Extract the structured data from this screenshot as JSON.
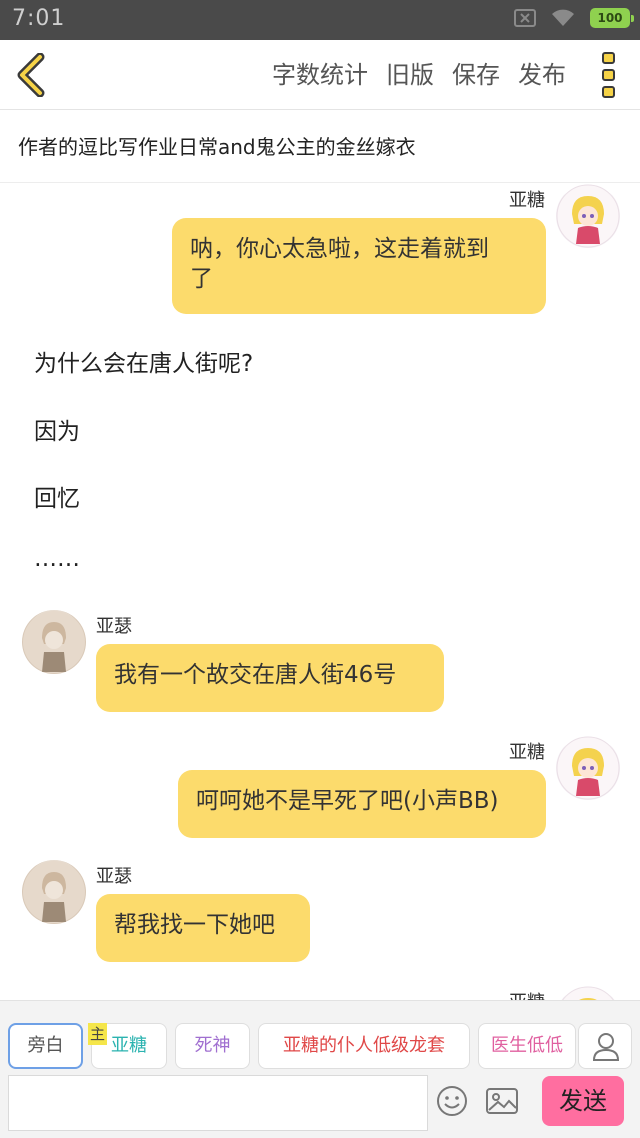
{
  "status_bar": {
    "time": "7:01",
    "battery": "100"
  },
  "toolbar": {
    "actions": [
      "字数统计",
      "旧版",
      "保存",
      "发布"
    ]
  },
  "title": "作者的逗比写作业日常and鬼公主的金丝嫁衣",
  "messages": [
    {
      "speaker": "亚糖",
      "text_line1": "呐，你心太急啦，这走着就到",
      "text_line2": "了"
    },
    {
      "narration": [
        "为什么会在唐人街呢?",
        "因为",
        "回忆",
        "……"
      ]
    },
    {
      "speaker": "亚瑟",
      "text": "我有一个故交在唐人街46号"
    },
    {
      "speaker": "亚糖",
      "text": "呵呵她不是早死了吧(小声BB)"
    },
    {
      "speaker": "亚瑟",
      "text": "帮我找一下她吧"
    },
    {
      "speaker": "亚糖"
    }
  ],
  "role_bar": {
    "host_badge": "主",
    "chips": [
      {
        "label": "旁白",
        "color": "#555555"
      },
      {
        "label": "亚糖",
        "color": "#2bb3b0"
      },
      {
        "label": "死神",
        "color": "#a06fd0"
      },
      {
        "label": "亚糖的仆人低级龙套",
        "color": "#e04848"
      },
      {
        "label": "医生低低",
        "color": "#e060a0"
      }
    ]
  },
  "composer": {
    "placeholder": "",
    "send_label": "发送"
  },
  "colors": {
    "bubble": "#fcdb6c",
    "send_button": "#ff6ea0",
    "accent_icon": "#f6d347"
  }
}
